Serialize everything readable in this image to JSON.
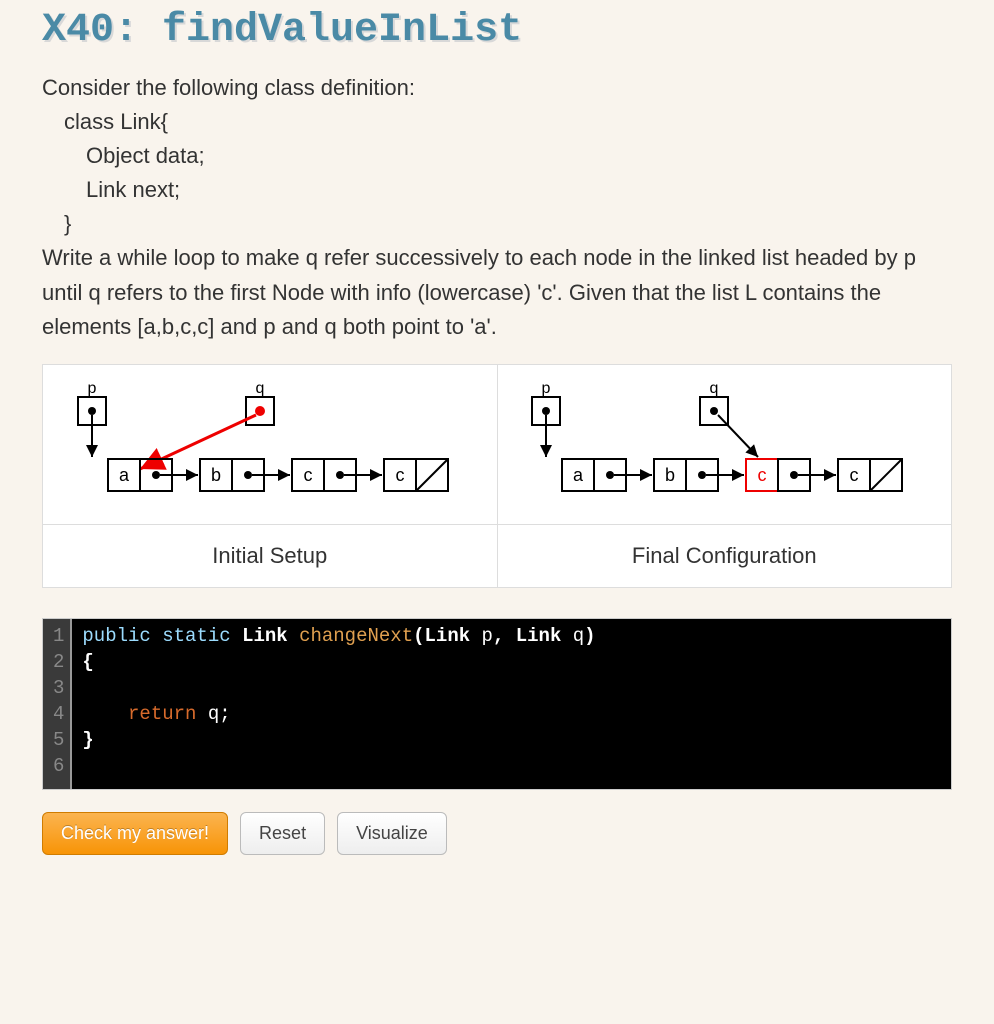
{
  "title": "X40: findValueInList",
  "intro_line": "Consider the following class definition:",
  "class_def": {
    "line1": "class Link{",
    "line2": "Object data;",
    "line3": "Link next;",
    "line4": "}"
  },
  "instructions": "Write a while loop to make q refer successively to each node in the linked list headed by p until q refers to the first Node with info (lowercase) 'c'. Given that the list L contains the elements [a,b,c,c] and p and q both point to 'a'.",
  "diagrams": {
    "initial_caption": "Initial Setup",
    "final_caption": "Final Configuration",
    "pointers": {
      "p": "p",
      "q": "q"
    },
    "nodes": [
      "a",
      "b",
      "c",
      "c"
    ]
  },
  "code": {
    "lines": [
      {
        "n": "1",
        "tokens": [
          "public",
          " ",
          "static",
          " ",
          "Link",
          " ",
          "changeNext",
          "(",
          "Link",
          " ",
          "p",
          ",",
          " ",
          "Link",
          " ",
          "q",
          ")"
        ]
      },
      {
        "n": "2",
        "text": "{"
      },
      {
        "n": "3",
        "text": ""
      },
      {
        "n": "4",
        "text_prefix": "    ",
        "ret": "return",
        "text_suffix": " q;"
      },
      {
        "n": "5",
        "text": "}"
      },
      {
        "n": "6",
        "text": ""
      }
    ],
    "kw_public": "public",
    "kw_static": "static",
    "kw_Link": "Link",
    "fn_name": "changeNext",
    "kw_return": "return",
    "param_p": "p",
    "param_q": "q"
  },
  "buttons": {
    "check": "Check my answer!",
    "reset": "Reset",
    "visualize": "Visualize"
  }
}
